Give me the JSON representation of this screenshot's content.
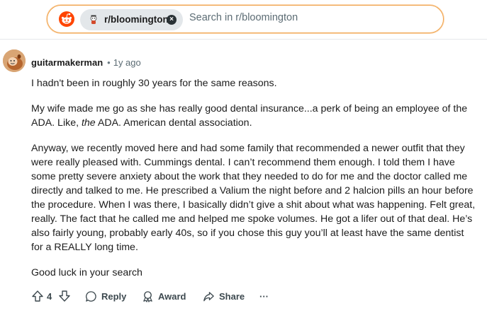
{
  "search": {
    "community": "r/bloomington",
    "placeholder": "Search in r/bloomington",
    "close_symbol": "×"
  },
  "comment": {
    "author": "guitarmakerman",
    "separator": "•",
    "age": "1y ago",
    "paragraphs": {
      "p1": "I hadn't been in roughly 30 years for the same reasons.",
      "p2a": "My wife made me go as she has really good dental insurance...a perk of being an employee of the ADA. Like, ",
      "p2b": "the",
      "p2c": " ADA. American dental association.",
      "p3": "Anyway, we recently moved here and had some family that recommended a newer outfit that they were really pleased with. Cummings dental. I can’t recommend them enough. I told them I have some pretty severe anxiety about the work that they needed to do for me and the doctor called me directly and talked to me. He prescribed a Valium the night before and 2 halcion pills an hour before the procedure. When I was there, I basically didn’t give a shit about what was happening. Felt great, really. The fact that he called me and helped me spoke volumes. He got a lifer out of that deal. He’s also fairly young, probably early 40s, so if you chose this guy you’ll at least have the same dentist for a REALLY long time.",
      "p4": "Good luck in your search"
    },
    "actions": {
      "vote_count": "4",
      "reply": "Reply",
      "award": "Award",
      "share": "Share",
      "more": "···"
    }
  },
  "icons": {
    "logo": "reddit-logo-icon",
    "upvote": "upvote-arrow-icon",
    "downvote": "downvote-arrow-icon",
    "reply": "speech-bubble-icon",
    "award": "award-ribbon-icon",
    "share": "share-arrow-icon"
  },
  "colors": {
    "brand": "#ff4500",
    "search_border": "#f0a24a",
    "chip_bg": "#e3e7ea",
    "text": "#1c1c1c",
    "muted": "#5c6c74"
  }
}
